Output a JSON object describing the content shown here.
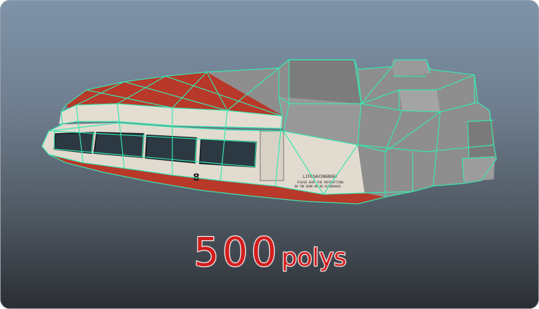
{
  "caption": {
    "count": "500",
    "unit": "polys"
  },
  "model": {
    "hull_number": "8",
    "decal_line_1": "LIFESAVINGBOAT",
    "decal_line_2": "PLEASE KEEP THE INSTRUCTIONS",
    "decal_line_3": "ON THE DOOR OR IN ACCORDANCE"
  },
  "colors": {
    "wireframe": "#37e8b0",
    "hull_red": "#b8382a",
    "hull_white": "#e4ddd2",
    "glass": "#2c3942",
    "shaded_gray": "#8e8e8e",
    "caption_red": "#d21d1d"
  }
}
